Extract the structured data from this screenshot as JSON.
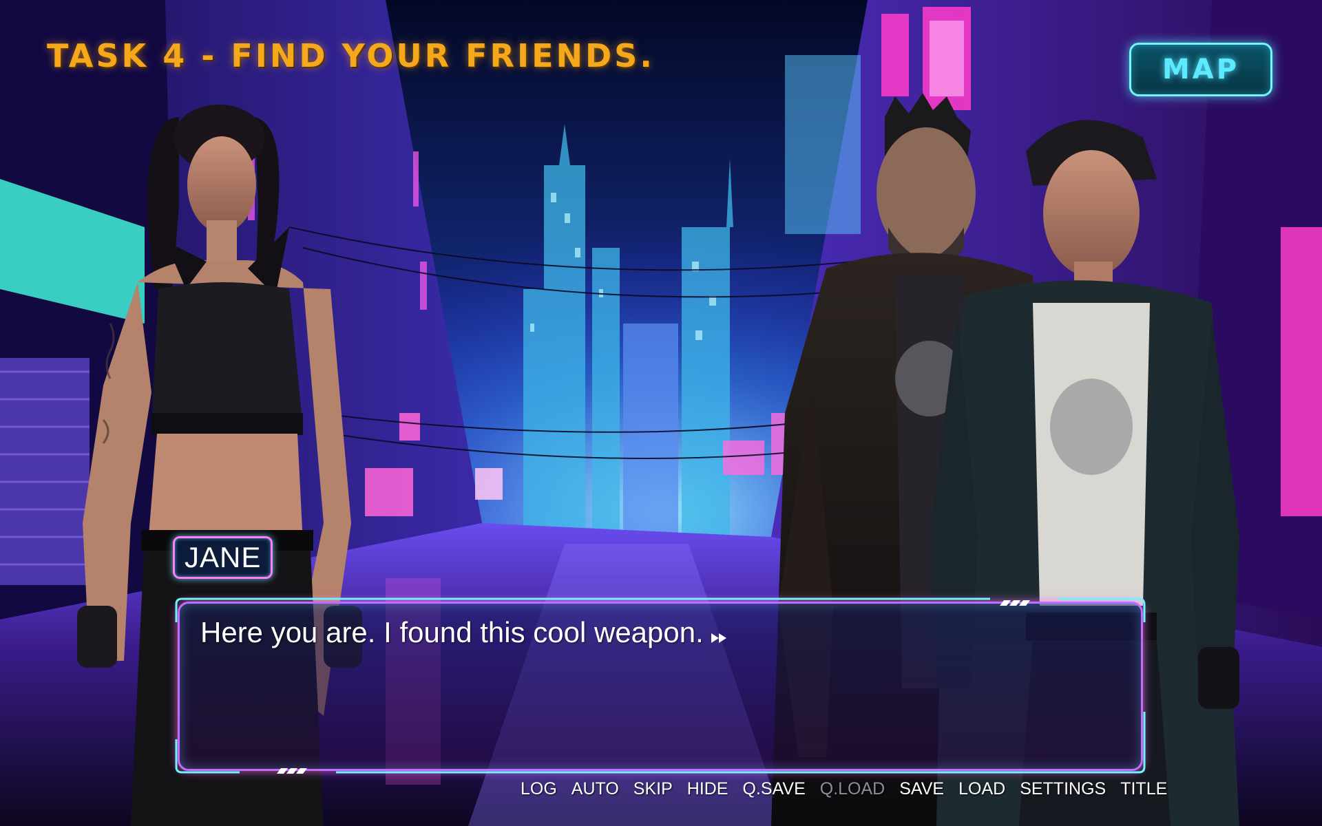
{
  "task": {
    "title": "TASK 4 - FIND YOUR FRIENDS.",
    "color": "#f5a81c"
  },
  "map_button": {
    "label": "MAP",
    "color": "#5de9ff"
  },
  "dialogue": {
    "speaker": "JANE",
    "text": "Here you are. I found this cool weapon.",
    "advance_icon": "fast-forward-icon"
  },
  "quick_menu": {
    "items": [
      {
        "label": "LOG",
        "enabled": true
      },
      {
        "label": "AUTO",
        "enabled": true
      },
      {
        "label": "SKIP",
        "enabled": true
      },
      {
        "label": "HIDE",
        "enabled": true
      },
      {
        "label": "Q.SAVE",
        "enabled": true
      },
      {
        "label": "Q.LOAD",
        "enabled": false
      },
      {
        "label": "SAVE",
        "enabled": true
      },
      {
        "label": "LOAD",
        "enabled": true
      },
      {
        "label": "SETTINGS",
        "enabled": true
      },
      {
        "label": "TITLE",
        "enabled": true
      }
    ]
  },
  "colors": {
    "frame_cyan": "#6ff3ff",
    "frame_magenta": "#ff6cff",
    "disabled_text": "#8d8d9c"
  }
}
